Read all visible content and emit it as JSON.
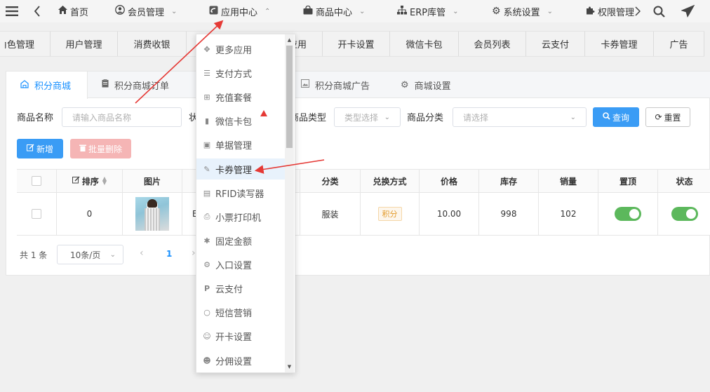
{
  "topnav": {
    "items": [
      {
        "label": "首页",
        "icon": "home-icon"
      },
      {
        "label": "会员管理",
        "icon": "user-circle-icon"
      },
      {
        "label": "应用中心",
        "icon": "app-icon"
      },
      {
        "label": "商品中心",
        "icon": "bag-icon"
      },
      {
        "label": "ERP库管",
        "icon": "sitemap-icon"
      },
      {
        "label": "系统设置",
        "icon": "gear-icon"
      },
      {
        "label": "权限管理",
        "icon": "puzzle-icon"
      }
    ]
  },
  "tabrow": {
    "tabs": [
      "角色管理",
      "用户管理",
      "消费收银",
      "应用",
      "开卡设置",
      "微信卡包",
      "会员列表",
      "云支付",
      "卡券管理",
      "广告"
    ]
  },
  "subtabs": [
    {
      "label": "积分商城",
      "icon": "home-outline-icon"
    },
    {
      "label": "积分商城订单",
      "icon": "clipboard-icon"
    },
    {
      "label": "积分商城广告",
      "icon": "image-icon"
    },
    {
      "label": "商城设置",
      "icon": "gear-icon"
    }
  ],
  "filters": {
    "name_label": "商品名称",
    "name_placeholder": "请输入商品名称",
    "status_label": "状",
    "type_label": "商品类型",
    "type_placeholder": "类型选择",
    "category_label": "商品分类",
    "category_placeholder": "请选择",
    "query_btn": "查询",
    "reset_btn": "重置"
  },
  "actions": {
    "add_btn": "新增",
    "batch_delete_btn": "批量删除"
  },
  "table": {
    "headers": {
      "sort": "排序",
      "image": "图片",
      "category": "分类",
      "exchange": "兑换方式",
      "price": "价格",
      "stock": "库存",
      "sales": "销量",
      "top": "置顶",
      "status": "状态"
    },
    "rows": [
      {
        "sort": "0",
        "name_partial": "E",
        "category": "服装",
        "exchange": "积分",
        "price": "10.00",
        "stock": "998",
        "sales": "102",
        "top": true,
        "status": true
      }
    ]
  },
  "pager": {
    "total": "共 1 条",
    "page_size": "10条/页",
    "current_page": "1"
  },
  "dropdown": {
    "items": [
      {
        "label": "更多应用",
        "icon": "arrows-icon"
      },
      {
        "label": "支付方式",
        "icon": "sliders-icon"
      },
      {
        "label": "充值套餐",
        "icon": "calendar-plus-icon"
      },
      {
        "label": "微信卡包",
        "icon": "folder-open-icon"
      },
      {
        "label": "单据管理",
        "icon": "file-icon"
      },
      {
        "label": "卡券管理",
        "icon": "edit-icon"
      },
      {
        "label": "RFID读写器",
        "icon": "card-icon"
      },
      {
        "label": "小票打印机",
        "icon": "print-icon"
      },
      {
        "label": "固定金额",
        "icon": "asterisk-icon"
      },
      {
        "label": "入口设置",
        "icon": "gear-icon"
      },
      {
        "label": "云支付",
        "icon": "paypal-icon"
      },
      {
        "label": "短信营销",
        "icon": "comment-icon"
      },
      {
        "label": "开卡设置",
        "icon": "user-icon"
      },
      {
        "label": "分佣设置",
        "icon": "users-icon"
      }
    ],
    "highlighted_index": 5
  },
  "colors": {
    "accent": "#1890ff",
    "button_blue": "#3a9cf5",
    "switch_green": "#5cb85c",
    "annotation_red": "#e53935"
  }
}
